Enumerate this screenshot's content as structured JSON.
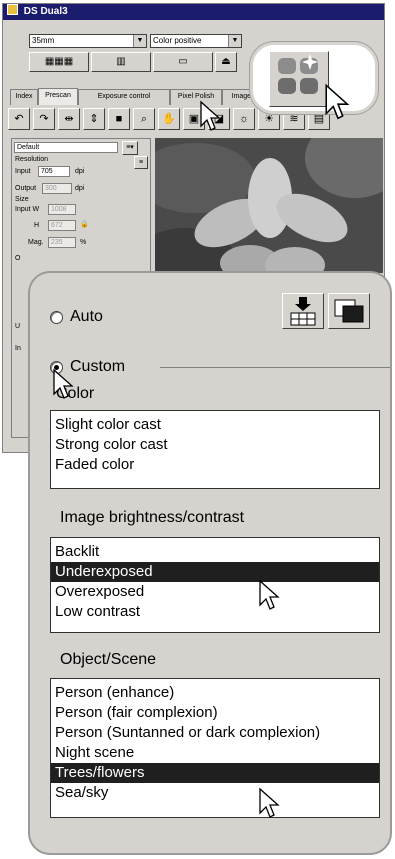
{
  "window": {
    "title": "DS Dual3"
  },
  "toolbar": {
    "film_format": "35mm",
    "film_type": "Color positive"
  },
  "tabs": [
    {
      "label": "Index"
    },
    {
      "label": "Prescan",
      "active": true
    },
    {
      "label": "Exposure control"
    },
    {
      "label": "Pixel Polish"
    },
    {
      "label": "Image co"
    }
  ],
  "settings_panel": {
    "preset": "Default",
    "resolution_label": "Resolution",
    "input_label": "Input",
    "input_value": "705",
    "input_unit": "dpi",
    "output_label": "Output",
    "output_value": "300",
    "output_unit": "dpi",
    "size_label": "Size",
    "input_w_label": "Input W",
    "input_w_value": "1008",
    "h_label": "H",
    "h_value": "672",
    "mag_label": "Mag.",
    "mag_value": "235",
    "mag_unit": "%",
    "frag_o": "O",
    "frag_u": "U",
    "frag_in": "In"
  },
  "polish_panel": {
    "auto_label": "Auto",
    "custom_label": "Custom",
    "selected_mode": "Custom",
    "color_section": {
      "title": "Color",
      "items": [
        "Slight color cast",
        "Strong color cast",
        "Faded color"
      ]
    },
    "brightness_section": {
      "title": "Image brightness/contrast",
      "items": [
        "Backlit",
        "Underexposed",
        "Overexposed",
        "Low contrast"
      ],
      "selected": "Underexposed"
    },
    "scene_section": {
      "title": "Object/Scene",
      "items": [
        "Person (enhance)",
        "Person (fair complexion)",
        "Person (Suntanned or dark complexion)",
        "Night scene",
        "Trees/flowers",
        "Sea/sky"
      ],
      "selected": "Trees/flowers"
    }
  }
}
